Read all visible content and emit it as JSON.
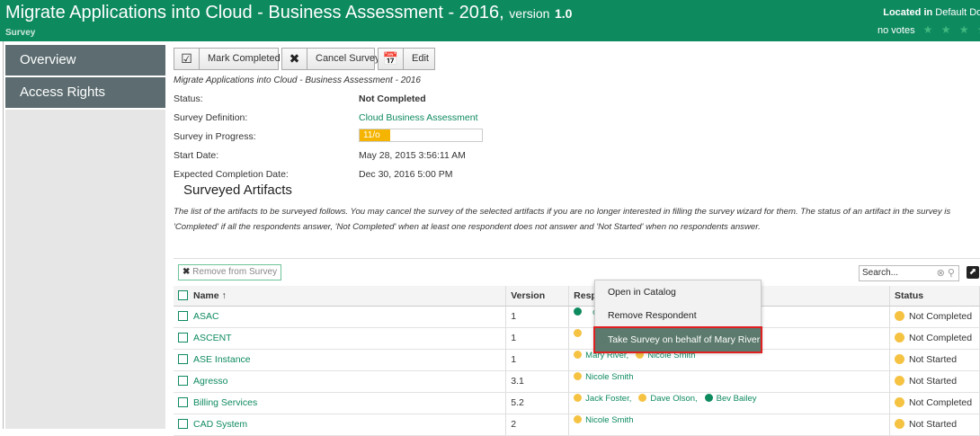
{
  "header": {
    "title": "Migrate Applications into Cloud - Business Assessment - 2016,",
    "version_label": "version",
    "version_number": "1.0",
    "subtitle": "Survey",
    "located_in_label": "Located in",
    "located_in_value": "Default Domai",
    "votes_text": "no votes",
    "stars": "★ ★ ★ ★ ★"
  },
  "sidebar": {
    "items": [
      {
        "label": "Overview"
      },
      {
        "label": "Access Rights"
      }
    ]
  },
  "toolbar": {
    "mark_completed": "Mark Completed",
    "cancel_survey": "Cancel Survey",
    "edit": "Edit"
  },
  "breadcrumb": "Migrate Applications into Cloud - Business Assessment - 2016",
  "properties": {
    "status_label": "Status:",
    "status_value": "Not Completed",
    "definition_label": "Survey Definition:",
    "definition_value": "Cloud Business Assessment",
    "progress_label": "Survey in Progress:",
    "progress_text": "11/o",
    "progress_fraction": 0.25,
    "start_label": "Start Date:",
    "start_value": "May 28, 2015 3:56:11 AM",
    "expected_label": "Expected Completion Date:",
    "expected_value": "Dec 30, 2016 5:00 PM"
  },
  "section": {
    "title": "Surveyed Artifacts",
    "description": "The list of the artifacts to be surveyed follows. You may cancel the survey of the selected artifacts if you are no longer interested in filling the survey wizard for them. The status of an artifact in the survey is 'Completed' if all the respondents answer, 'Not Completed' when at least one respondent does not answer and 'Not Started' when no respondents answer."
  },
  "grid": {
    "remove_label": "Remove from Survey",
    "search_placeholder": "Search...",
    "columns": {
      "name": "Name ↑",
      "version": "Version",
      "respondents": "Resp",
      "status": "Status"
    },
    "rows": [
      {
        "name": "ASAC",
        "version": "1",
        "respondents": [
          {
            "name": "",
            "state": "green"
          },
          {
            "name": "on",
            "state": "none"
          }
        ],
        "status": "Not Completed"
      },
      {
        "name": "ASCENT",
        "version": "1",
        "respondents": [
          {
            "name": "",
            "state": "yellow"
          }
        ],
        "status": "Not Completed"
      },
      {
        "name": "ASE Instance",
        "version": "1",
        "respondents": [
          {
            "name": "Mary River,",
            "state": "yellow"
          },
          {
            "name": "Nicole Smith",
            "state": "yellow"
          }
        ],
        "status": "Not Started"
      },
      {
        "name": "Agresso",
        "version": "3.1",
        "respondents": [
          {
            "name": "Nicole Smith",
            "state": "yellow"
          }
        ],
        "status": "Not Started"
      },
      {
        "name": "Billing Services",
        "version": "5.2",
        "respondents": [
          {
            "name": "Jack Foster,",
            "state": "yellow"
          },
          {
            "name": "Dave Olson,",
            "state": "yellow"
          },
          {
            "name": "Bev Bailey",
            "state": "green"
          }
        ],
        "status": "Not Completed"
      },
      {
        "name": "CAD System",
        "version": "2",
        "respondents": [
          {
            "name": "Nicole Smith",
            "state": "yellow"
          }
        ],
        "status": "Not Started"
      }
    ]
  },
  "context_menu": {
    "items": [
      {
        "label": "Open in Catalog"
      },
      {
        "label": "Remove Respondent"
      },
      {
        "label": "Take Survey on behalf of Mary River"
      }
    ]
  }
}
